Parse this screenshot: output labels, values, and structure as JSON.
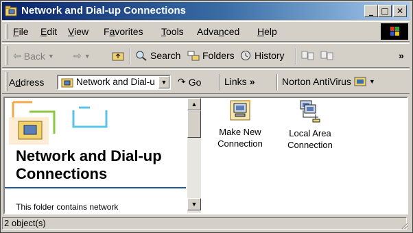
{
  "window": {
    "title": "Network and Dial-up Connections"
  },
  "caption_buttons": {
    "minimize": "_",
    "maximize": "□",
    "close": "✕"
  },
  "menu": [
    {
      "label": "File",
      "u": "F",
      "rest": "ile"
    },
    {
      "label": "Edit",
      "u": "E",
      "rest": "dit"
    },
    {
      "label": "View",
      "u": "V",
      "rest": "iew"
    },
    {
      "label": "Favorites",
      "pre": "F",
      "u": "a",
      "rest": "vorites"
    },
    {
      "label": "Tools",
      "u": "T",
      "rest": "ools"
    },
    {
      "label": "Advanced",
      "pre": "Adva",
      "u": "n",
      "rest": "ced"
    },
    {
      "label": "Help",
      "u": "H",
      "rest": "elp"
    }
  ],
  "toolbar": {
    "back": "Back",
    "search": "Search",
    "folders": "Folders",
    "history": "History",
    "overflow": "»"
  },
  "address": {
    "label_pre": "A",
    "label_u": "d",
    "label_rest": "dress",
    "value": "Network and Dial-u",
    "go": "Go",
    "links": "Links",
    "links_chevron": "»",
    "norton": "Norton AntiVirus"
  },
  "left_pane": {
    "title": "Network and Dial-up Connections",
    "description": "This folder contains network"
  },
  "items": [
    {
      "label_line1": "Make New",
      "label_line2": "Connection",
      "icon": "make-new-connection-icon"
    },
    {
      "label_line1": "Local Area",
      "label_line2": "Connection",
      "icon": "local-area-connection-icon"
    }
  ],
  "status": {
    "text": "2 object(s)"
  },
  "colors": {
    "title_start": "#0a246a",
    "title_end": "#a6caf0",
    "face": "#d4d0c8",
    "accent_line": "#1e5aa0"
  }
}
